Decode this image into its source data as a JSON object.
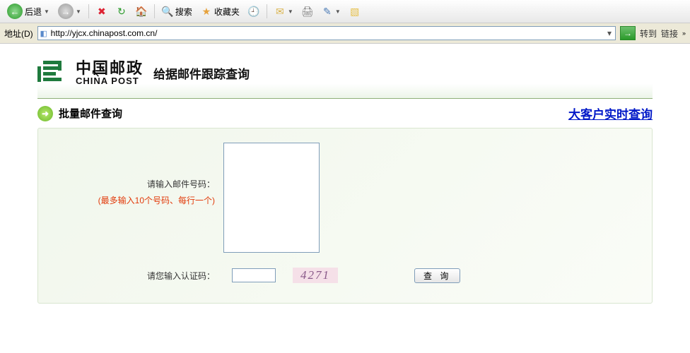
{
  "toolbar": {
    "back_label": "后退",
    "search_label": "搜索",
    "fav_label": "收藏夹"
  },
  "address_bar": {
    "label": "地址(D)",
    "url": "http://yjcx.chinapost.com.cn/",
    "go_label": "转到",
    "links_label": "链接"
  },
  "brand": {
    "cn": "中国邮政",
    "en": "CHINA POST"
  },
  "page_title": "给据邮件跟踪查询",
  "sub": {
    "batch_title": "批量邮件查询",
    "vip_link": "大客户实时查询"
  },
  "form": {
    "mail_label": "请输入邮件号码：",
    "mail_hint": "(最多输入10个号码、每行一个)",
    "captcha_label": "请您输入认证码：",
    "captcha_value": "4271",
    "query_button": "查 询"
  }
}
